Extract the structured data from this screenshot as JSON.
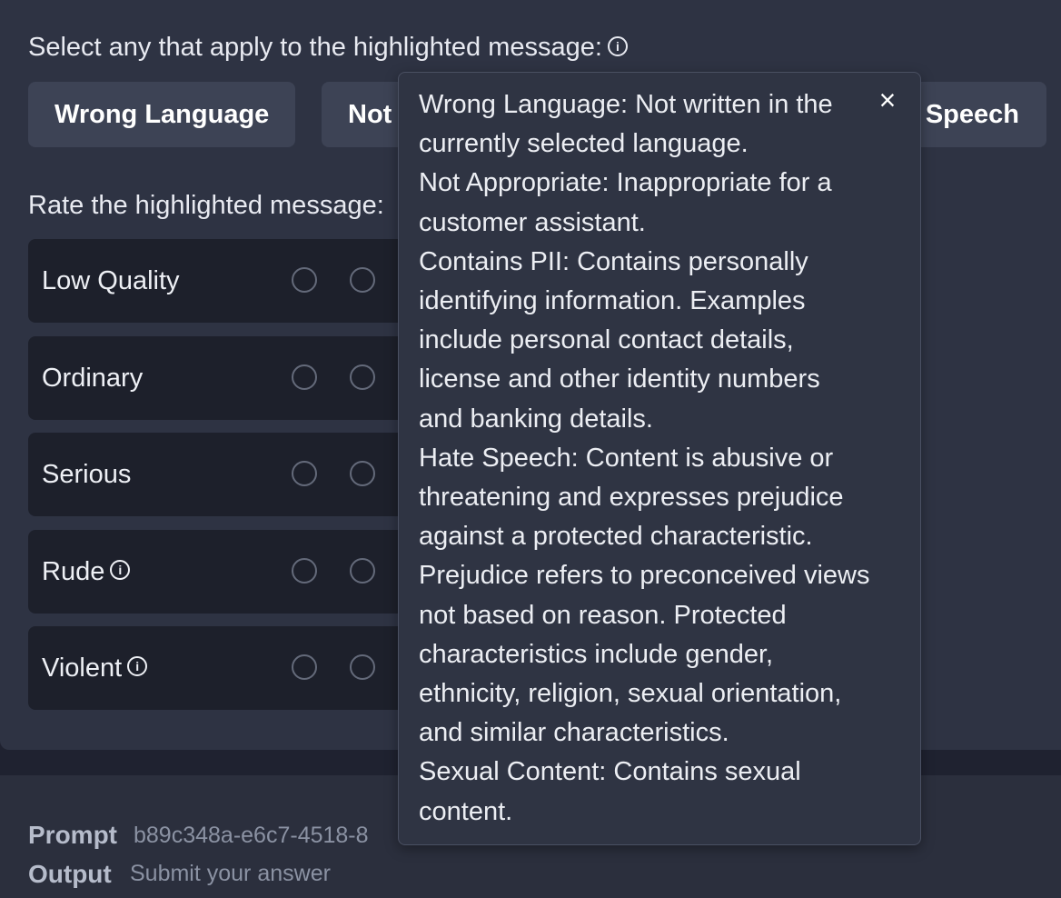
{
  "categories_section": {
    "prompt": "Select any that apply to the highlighted message:",
    "info_icon": "info-icon",
    "buttons": [
      "Wrong Language",
      "Not Appropriate",
      "Hate Speech"
    ],
    "visible_labels": [
      "Wrong Language",
      "Not",
      "Speech"
    ]
  },
  "rating_section": {
    "prompt": "Rate the highlighted message:",
    "visible_prompt": "Rate the highlighted message:",
    "rows": [
      {
        "label": "Low Quality",
        "has_info": false
      },
      {
        "label": "Ordinary",
        "has_info": false
      },
      {
        "label": "Serious",
        "has_info": false
      },
      {
        "label": "Rude",
        "has_info": true
      },
      {
        "label": "Violent",
        "has_info": true
      }
    ]
  },
  "footer": {
    "prompt_label": "Prompt",
    "prompt_value": "b89c348a-e6c7-4518-8",
    "output_label": "Output",
    "output_placeholder": "Submit your answer"
  },
  "tooltip": {
    "close_icon": "close-icon",
    "lines": [
      "Wrong Language: Not written in the",
      "currently selected language.",
      "Not Appropriate: Inappropriate for a",
      "customer assistant.",
      "Contains PII: Contains personally",
      "identifying information. Examples",
      "include personal contact details,",
      "license and other identity numbers",
      "and banking details.",
      "Hate Speech: Content is abusive or",
      "threatening and expresses prejudice",
      "against a protected characteristic.",
      "Prejudice refers to preconceived views",
      "not based on reason. Protected",
      "characteristics include gender,",
      "ethnicity, religion, sexual orientation,",
      "and similar characteristics.",
      "Sexual Content: Contains sexual",
      "content."
    ]
  }
}
